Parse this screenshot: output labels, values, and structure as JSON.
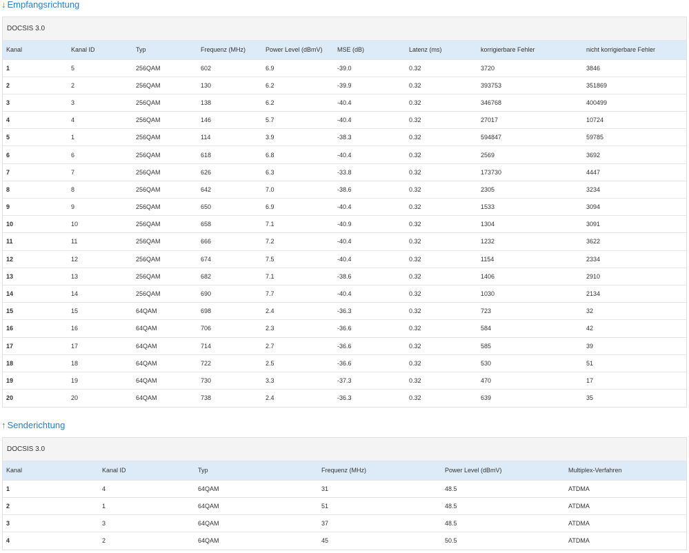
{
  "downstream": {
    "arrow": "↓",
    "title": "Empfangsrichtung",
    "docsis": "DOCSIS 3.0",
    "headers": [
      "Kanal",
      "Kanal ID",
      "Typ",
      "Frequenz (MHz)",
      "Power Level (dBmV)",
      "MSE (dB)",
      "Latenz (ms)",
      "korrigierbare Fehler",
      "nicht korrigierbare Fehler"
    ],
    "rows": [
      [
        "1",
        "5",
        "256QAM",
        "602",
        "6.9",
        "-39.0",
        "0.32",
        "3720",
        "3846"
      ],
      [
        "2",
        "2",
        "256QAM",
        "130",
        "6.2",
        "-39.9",
        "0.32",
        "393753",
        "351869"
      ],
      [
        "3",
        "3",
        "256QAM",
        "138",
        "6.2",
        "-40.4",
        "0.32",
        "346768",
        "400499"
      ],
      [
        "4",
        "4",
        "256QAM",
        "146",
        "5.7",
        "-40.4",
        "0.32",
        "27017",
        "10724"
      ],
      [
        "5",
        "1",
        "256QAM",
        "114",
        "3.9",
        "-38.3",
        "0.32",
        "594847",
        "59785"
      ],
      [
        "6",
        "6",
        "256QAM",
        "618",
        "6.8",
        "-40.4",
        "0.32",
        "2569",
        "3692"
      ],
      [
        "7",
        "7",
        "256QAM",
        "626",
        "6.3",
        "-33.8",
        "0.32",
        "173730",
        "4447"
      ],
      [
        "8",
        "8",
        "256QAM",
        "642",
        "7.0",
        "-38.6",
        "0.32",
        "2305",
        "3234"
      ],
      [
        "9",
        "9",
        "256QAM",
        "650",
        "6.9",
        "-40.4",
        "0.32",
        "1533",
        "3094"
      ],
      [
        "10",
        "10",
        "256QAM",
        "658",
        "7.1",
        "-40.9",
        "0.32",
        "1304",
        "3091"
      ],
      [
        "11",
        "11",
        "256QAM",
        "666",
        "7.2",
        "-40.4",
        "0.32",
        "1232",
        "3622"
      ],
      [
        "12",
        "12",
        "256QAM",
        "674",
        "7.5",
        "-40.4",
        "0.32",
        "1154",
        "2334"
      ],
      [
        "13",
        "13",
        "256QAM",
        "682",
        "7.1",
        "-38.6",
        "0.32",
        "1406",
        "2910"
      ],
      [
        "14",
        "14",
        "256QAM",
        "690",
        "7.7",
        "-40.4",
        "0.32",
        "1030",
        "2134"
      ],
      [
        "15",
        "15",
        "64QAM",
        "698",
        "2.4",
        "-36.3",
        "0.32",
        "723",
        "32"
      ],
      [
        "16",
        "16",
        "64QAM",
        "706",
        "2.3",
        "-36.6",
        "0.32",
        "584",
        "42"
      ],
      [
        "17",
        "17",
        "64QAM",
        "714",
        "2.7",
        "-36.6",
        "0.32",
        "585",
        "39"
      ],
      [
        "18",
        "18",
        "64QAM",
        "722",
        "2.5",
        "-36.6",
        "0.32",
        "530",
        "51"
      ],
      [
        "19",
        "19",
        "64QAM",
        "730",
        "3.3",
        "-37.3",
        "0.32",
        "470",
        "17"
      ],
      [
        "20",
        "20",
        "64QAM",
        "738",
        "2.4",
        "-36.3",
        "0.32",
        "639",
        "35"
      ]
    ]
  },
  "upstream": {
    "arrow": "↑",
    "title": "Senderichtung",
    "docsis": "DOCSIS 3.0",
    "headers": [
      "Kanal",
      "Kanal ID",
      "Typ",
      "Frequenz (MHz)",
      "Power Level (dBmV)",
      "Multiplex-Verfahren"
    ],
    "rows": [
      [
        "1",
        "4",
        "64QAM",
        "31",
        "48.5",
        "ATDMA"
      ],
      [
        "2",
        "1",
        "64QAM",
        "51",
        "48.5",
        "ATDMA"
      ],
      [
        "3",
        "3",
        "64QAM",
        "37",
        "48.5",
        "ATDMA"
      ],
      [
        "4",
        "2",
        "64QAM",
        "45",
        "50.5",
        "ATDMA"
      ]
    ]
  }
}
